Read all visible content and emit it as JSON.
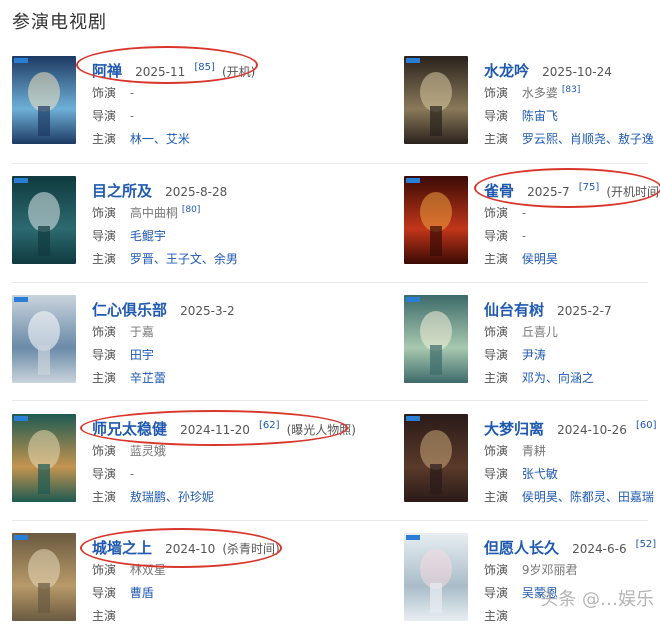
{
  "section_title": "参演电视剧",
  "labels": {
    "role": "饰演",
    "director": "导演",
    "stars": "主演"
  },
  "dramas": [
    {
      "title": "阿禅",
      "date": "2025-11",
      "score": "[85]",
      "note": "(开机)",
      "role": "-",
      "director": "-",
      "stars": "林一、艾米",
      "role_score": ""
    },
    {
      "title": "水龙吟",
      "date": "2025-10-24",
      "score": "",
      "note": "",
      "role": "水多婆",
      "role_score": "[83]",
      "director": "陈宙飞",
      "stars": "罗云熙、肖顺尧、敖子逸"
    },
    {
      "title": "目之所及",
      "date": "2025-8-28",
      "score": "",
      "note": "",
      "role": "高中曲桐",
      "role_score": "[80]",
      "director": "毛鲲宇",
      "stars": "罗晋、王子文、余男"
    },
    {
      "title": "雀骨",
      "date": "2025-7",
      "score": "[75]",
      "note": "(开机时间)",
      "role": "-",
      "role_score": "",
      "director": "-",
      "stars": "侯明昊"
    },
    {
      "title": "仁心俱乐部",
      "date": "2025-3-2",
      "score": "",
      "note": "",
      "role": "于嘉",
      "role_score": "",
      "director": "田宇",
      "stars": "辛芷蕾"
    },
    {
      "title": "仙台有树",
      "date": "2025-2-7",
      "score": "",
      "note": "",
      "role": "丘喜儿",
      "role_score": "",
      "director": "尹涛",
      "stars": "邓为、向涵之"
    },
    {
      "title": "师兄太稳健",
      "date": "2024-11-20",
      "score": "[62]",
      "note": "(曝光人物照)",
      "role": "蓝灵娥",
      "role_score": "",
      "director": "-",
      "stars": "敖瑞鹏、孙珍妮"
    },
    {
      "title": "大梦归离",
      "date": "2024-10-26",
      "score": "[60]",
      "note": "",
      "role": "青耕",
      "role_score": "",
      "director": "张弋敏",
      "stars": "侯明昊、陈都灵、田嘉瑞"
    },
    {
      "title": "城墙之上",
      "date": "2024-10",
      "score": "",
      "note": "(杀青时间)",
      "role": "林双星",
      "role_score": "",
      "director": "曹盾",
      "stars": ""
    },
    {
      "title": "但愿人长久",
      "date": "2024-6-6",
      "score": "[52]",
      "note": "",
      "role": "9岁邓丽君",
      "role_score": "",
      "director": "吴蒙恩",
      "stars": ""
    }
  ],
  "watermark": "头条 @…娱乐"
}
